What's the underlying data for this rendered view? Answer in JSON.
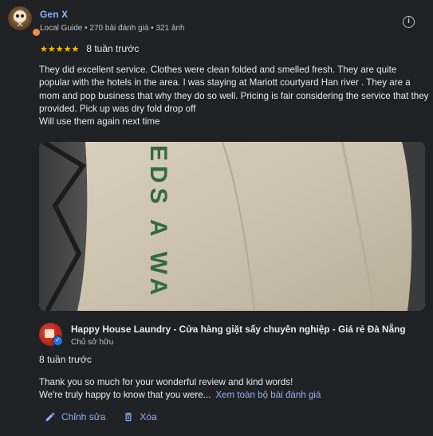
{
  "reviewer": {
    "name": "Gen X",
    "meta": "Local Guide • 270 bài đánh giá • 321 ảnh"
  },
  "review": {
    "stars": "★★★★★",
    "rating": 5,
    "date": "8 tuần trước",
    "text": "They did excellent service. Clothes were clean folded and smelled fresh. They are quite popular with the hotels in the area. I was staying at Mariott courtyard Han river . They are a mom and pop business that why they do so well. Pricing is fair considering the service that they provided. Pick up was dry fold drop off\nWill use them again next time",
    "photo_text": "EDS A WA"
  },
  "owner": {
    "name": "Happy House Laundry - Cửa hàng giặt sấy chuyên nghiệp - Giá rẻ Đà Nẵng",
    "role": "Chủ sở hữu"
  },
  "reply": {
    "date": "8 tuần trước",
    "line1": "Thank you so much for your wonderful review and kind words!",
    "line2": "We're truly happy to know that you were...",
    "see_more": "Xem toàn bộ bài đánh giá"
  },
  "actions": {
    "edit_label": "Chỉnh sửa",
    "delete_label": "Xóa"
  },
  "icons": {
    "info": "info-icon",
    "edit": "pencil-icon",
    "delete": "trash-icon"
  },
  "colors": {
    "background": "#202124",
    "link": "#8ab4f8",
    "star": "#fbbc04",
    "text": "#e8eaed",
    "muted": "#bdc1c6"
  }
}
